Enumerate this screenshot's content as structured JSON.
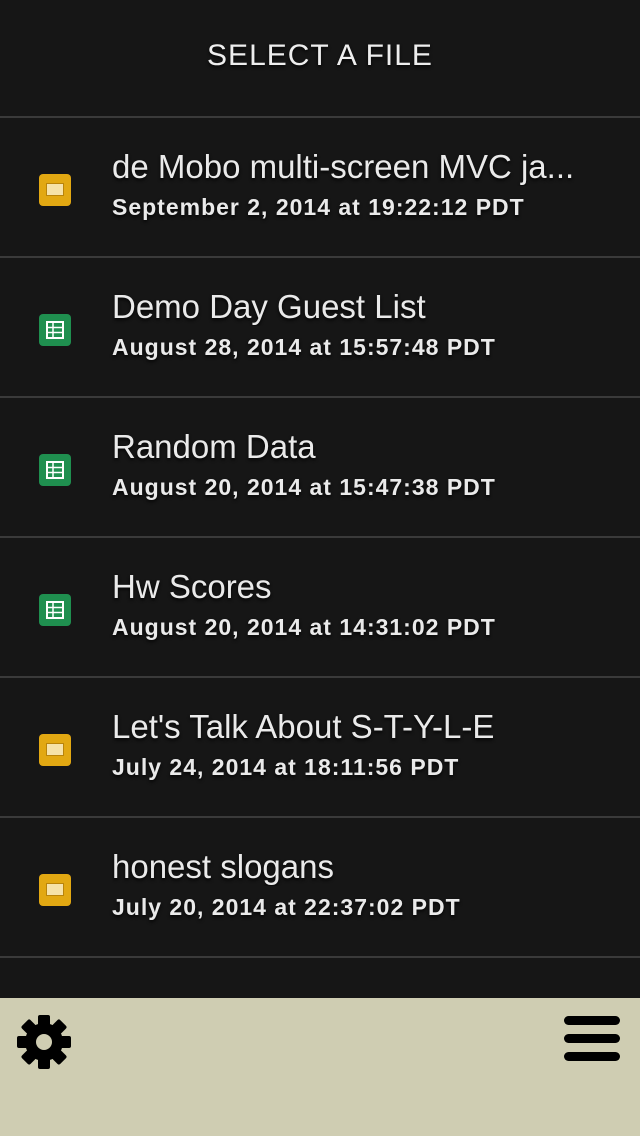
{
  "header": {
    "title": "SELECT A FILE"
  },
  "files": [
    {
      "name": "de Mobo multi-screen MVC ja...",
      "date": "September 2, 2014 at 19:22:12 PDT",
      "type": "slides-icon"
    },
    {
      "name": "Demo Day Guest List",
      "date": "August 28, 2014 at 15:57:48 PDT",
      "type": "sheets-icon"
    },
    {
      "name": "Random Data",
      "date": "August 20, 2014 at 15:47:38 PDT",
      "type": "sheets-icon"
    },
    {
      "name": "Hw Scores",
      "date": "August 20, 2014 at 14:31:02 PDT",
      "type": "sheets-icon"
    },
    {
      "name": "Let's Talk About S-T-Y-L-E",
      "date": "July 24, 2014 at 18:11:56 PDT",
      "type": "slides-icon"
    },
    {
      "name": "honest slogans",
      "date": "July 20, 2014 at 22:37:02 PDT",
      "type": "slides-icon"
    }
  ],
  "footer": {
    "settings_icon": "gear-icon",
    "menu_icon": "hamburger-menu-icon"
  },
  "colors": {
    "background": "#161616",
    "footer": "#cfcdb2",
    "slides": "#e2a812",
    "sheets": "#1f8f4f",
    "text": "#eaeaea"
  }
}
